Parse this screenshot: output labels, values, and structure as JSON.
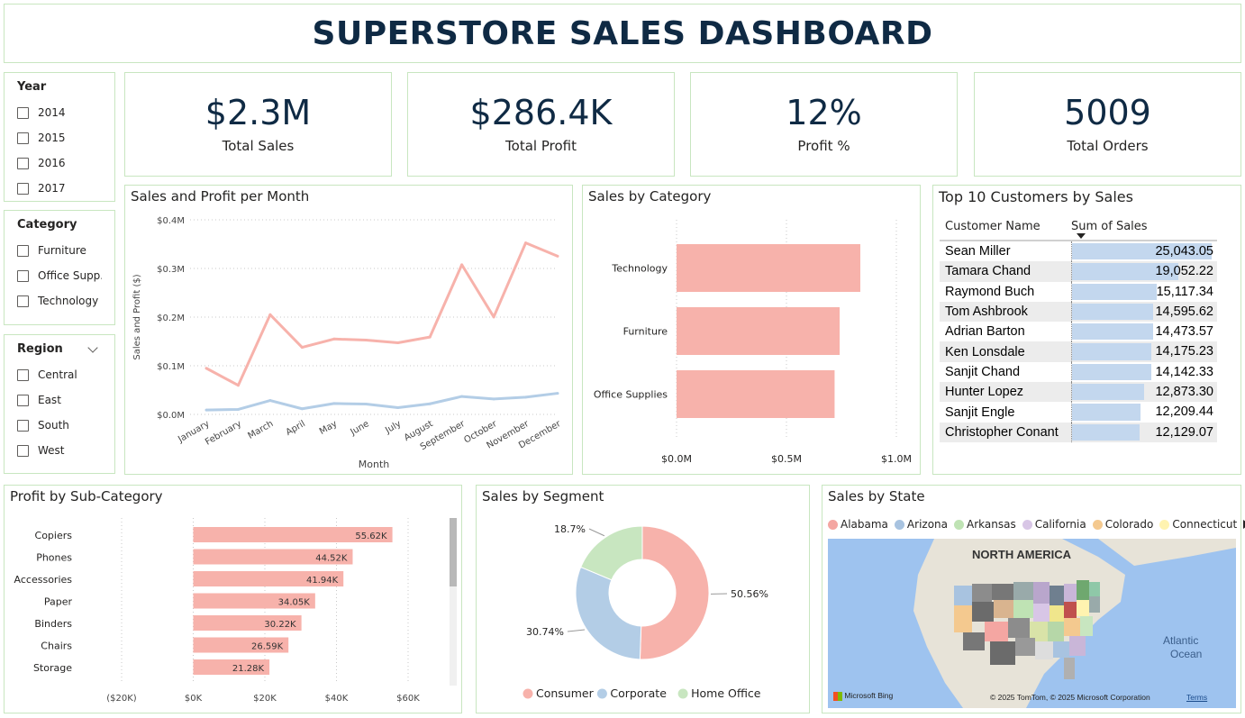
{
  "title": "SUPERSTORE SALES DASHBOARD",
  "slicers": {
    "year": {
      "title": "Year",
      "items": [
        "2014",
        "2015",
        "2016",
        "2017"
      ]
    },
    "category": {
      "title": "Category",
      "items": [
        "Furniture",
        "Office Supp...",
        "Technology"
      ]
    },
    "region": {
      "title": "Region",
      "items": [
        "Central",
        "East",
        "South",
        "West"
      ]
    }
  },
  "kpis": [
    {
      "value": "$2.3M",
      "label": "Total Sales"
    },
    {
      "value": "$286.4K",
      "label": "Total Profit"
    },
    {
      "value": "12%",
      "label": "Profit %"
    },
    {
      "value": "5009",
      "label": "Total Orders"
    }
  ],
  "panels": {
    "monthly": "Sales and Profit per Month",
    "category": "Sales by Category",
    "customers": "Top 10 Customers by Sales",
    "subcategory": "Profit by Sub-Category",
    "segment": "Sales by Segment",
    "state": "Sales by State"
  },
  "customers": {
    "col1": "Customer Name",
    "col2": "Sum of Sales",
    "rows": [
      {
        "name": "Sean Miller",
        "display": "25,043.05",
        "value": 25043.05
      },
      {
        "name": "Tamara Chand",
        "display": "19,052.22",
        "value": 19052.22
      },
      {
        "name": "Raymond Buch",
        "display": "15,117.34",
        "value": 15117.34
      },
      {
        "name": "Tom Ashbrook",
        "display": "14,595.62",
        "value": 14595.62
      },
      {
        "name": "Adrian Barton",
        "display": "14,473.57",
        "value": 14473.57
      },
      {
        "name": "Ken Lonsdale",
        "display": "14,175.23",
        "value": 14175.23
      },
      {
        "name": "Sanjit Chand",
        "display": "14,142.33",
        "value": 14142.33
      },
      {
        "name": "Hunter Lopez",
        "display": "12,873.30",
        "value": 12873.3
      },
      {
        "name": "Sanjit Engle",
        "display": "12,209.44",
        "value": 12209.44
      },
      {
        "name": "Christopher Conant",
        "display": "12,129.07",
        "value": 12129.07
      }
    ]
  },
  "map": {
    "legend": [
      "Alabama",
      "Arizona",
      "Arkansas",
      "California",
      "Colorado",
      "Connecticut"
    ],
    "legend_colors": [
      "#f4a6a2",
      "#a8c3e0",
      "#bfe3b4",
      "#d8c6e6",
      "#f4c98f",
      "#fff3b0"
    ],
    "label_continent": "NORTH AMERICA",
    "label_ocean_1": "Atlantic",
    "label_ocean_2": "Ocean",
    "provider": "Microsoft Bing",
    "copyright": "© 2025 TomTom, © 2025 Microsoft Corporation",
    "terms": "Terms"
  },
  "colors": {
    "sales": "#f7b2ab",
    "profit": "#b3cde6",
    "consumer": "#f7b2ab",
    "corporate": "#b3cde6",
    "home_office": "#c8e6c0",
    "title": "#0f2a44"
  },
  "chart_data": [
    {
      "id": "monthly",
      "type": "line",
      "title": "Sales and Profit per Month",
      "xlabel": "Month",
      "ylabel": "Sales and Profit ($)",
      "categories": [
        "January",
        "February",
        "March",
        "April",
        "May",
        "June",
        "July",
        "August",
        "September",
        "October",
        "November",
        "December"
      ],
      "series": [
        {
          "values": [
            94900,
            59800,
            205000,
            137800,
            155000,
            152700,
            147200,
            159000,
            307600,
            200300,
            352500,
            325300
          ]
        },
        {
          "values": [
            9100,
            10300,
            28600,
            11600,
            22400,
            21300,
            13800,
            21800,
            36900,
            31800,
            35500,
            43400
          ]
        }
      ],
      "yticks": [
        "$0.0M",
        "$0.1M",
        "$0.2M",
        "$0.3M",
        "$0.4M"
      ],
      "ylim": [
        0,
        400000
      ],
      "grid": true
    },
    {
      "id": "category",
      "type": "bar",
      "orientation": "horizontal",
      "title": "Sales by Category",
      "categories": [
        "Technology",
        "Furniture",
        "Office Supplies"
      ],
      "values": [
        836000,
        742000,
        719000
      ],
      "xticks": [
        "$0.0M",
        "$0.5M",
        "$1.0M"
      ],
      "xlim": [
        0,
        1000000
      ]
    },
    {
      "id": "subcategory",
      "type": "bar",
      "orientation": "horizontal",
      "title": "Profit by Sub-Category",
      "categories": [
        "Copiers",
        "Phones",
        "Accessories",
        "Paper",
        "Binders",
        "Chairs",
        "Storage"
      ],
      "values": [
        55620,
        44520,
        41940,
        34050,
        30220,
        26590,
        21280
      ],
      "labels": [
        "55.62K",
        "44.52K",
        "41.94K",
        "34.05K",
        "30.22K",
        "26.59K",
        "21.28K"
      ],
      "xticks": [
        "($20K)",
        "$0K",
        "$20K",
        "$40K",
        "$60K"
      ],
      "xlim": [
        -20000,
        60000
      ]
    },
    {
      "id": "segment",
      "type": "pie",
      "title": "Sales by Segment",
      "categories": [
        "Consumer",
        "Corporate",
        "Home Office"
      ],
      "values": [
        50.56,
        30.74,
        18.7
      ],
      "labels": [
        "50.56%",
        "30.74%",
        "18.7%"
      ],
      "legend_position": "bottom"
    }
  ]
}
